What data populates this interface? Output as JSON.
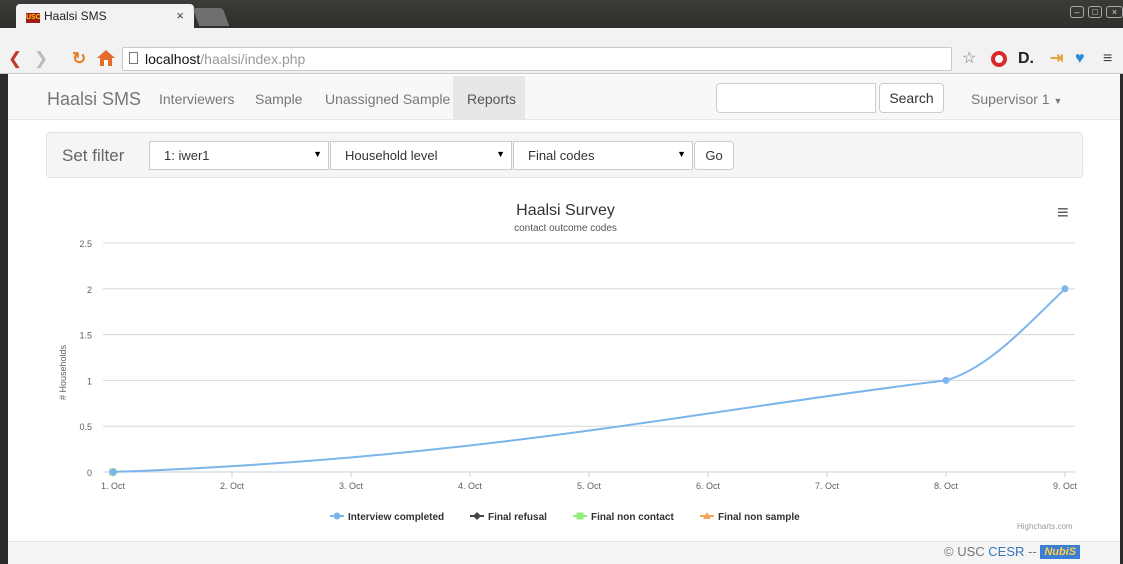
{
  "browser": {
    "tab_title": "Haalsi SMS",
    "tab_favicon_text": "USC",
    "tab_close": "×",
    "address_host": "localhost",
    "address_path": "/haalsi/index.php",
    "icons": [
      "back-icon",
      "forward-icon",
      "reload-icon",
      "home-icon",
      "page-icon",
      "star-icon",
      "opera-icon",
      "extension-d-icon",
      "extension-arrow-icon",
      "pocket-icon",
      "menu-icon"
    ]
  },
  "navbar": {
    "brand": "Haalsi SMS",
    "items": [
      {
        "label": "Interviewers"
      },
      {
        "label": "Sample"
      },
      {
        "label": "Unassigned Sample"
      },
      {
        "label": "Reports",
        "active": true
      }
    ],
    "search_value": "",
    "search_button": "Search",
    "user_menu": "Supervisor 1"
  },
  "filter": {
    "label": "Set filter",
    "interviewer": "1: iwer1",
    "level": "Household level",
    "codes": "Final codes",
    "go": "Go"
  },
  "chart_data": {
    "type": "line",
    "title": "Haalsi Survey",
    "subtitle": "contact outcome codes",
    "ylabel": "# Households",
    "xlabel": "",
    "categories": [
      "1. Oct",
      "2. Oct",
      "3. Oct",
      "4. Oct",
      "5. Oct",
      "6. Oct",
      "7. Oct",
      "8. Oct",
      "9. Oct"
    ],
    "ylim": [
      0,
      2.5
    ],
    "yticks": [
      "0",
      "0.5",
      "1",
      "1.5",
      "2",
      "2.5"
    ],
    "grid": true,
    "legend_position": "bottom",
    "series": [
      {
        "name": "Interview completed",
        "color": "#7cb5ec",
        "marker": "circle",
        "points": [
          {
            "x": 0,
            "y": 0
          },
          {
            "x": 7,
            "y": 1
          },
          {
            "x": 8,
            "y": 2
          }
        ]
      },
      {
        "name": "Final refusal",
        "color": "#434348",
        "marker": "diamond",
        "points": [
          {
            "x": 0,
            "y": 0
          }
        ]
      },
      {
        "name": "Final non contact",
        "color": "#90ed7d",
        "marker": "square",
        "points": [
          {
            "x": 0,
            "y": 0
          }
        ]
      },
      {
        "name": "Final non sample",
        "color": "#f7a35c",
        "marker": "triangle",
        "points": [
          {
            "x": 0,
            "y": 0
          }
        ]
      }
    ],
    "credits": "Highcharts.com",
    "menu_icon": "hamburger-icon"
  },
  "footer": {
    "copyright": "© USC",
    "link": "CESR",
    "separator": "--",
    "logo": "NubiS"
  }
}
